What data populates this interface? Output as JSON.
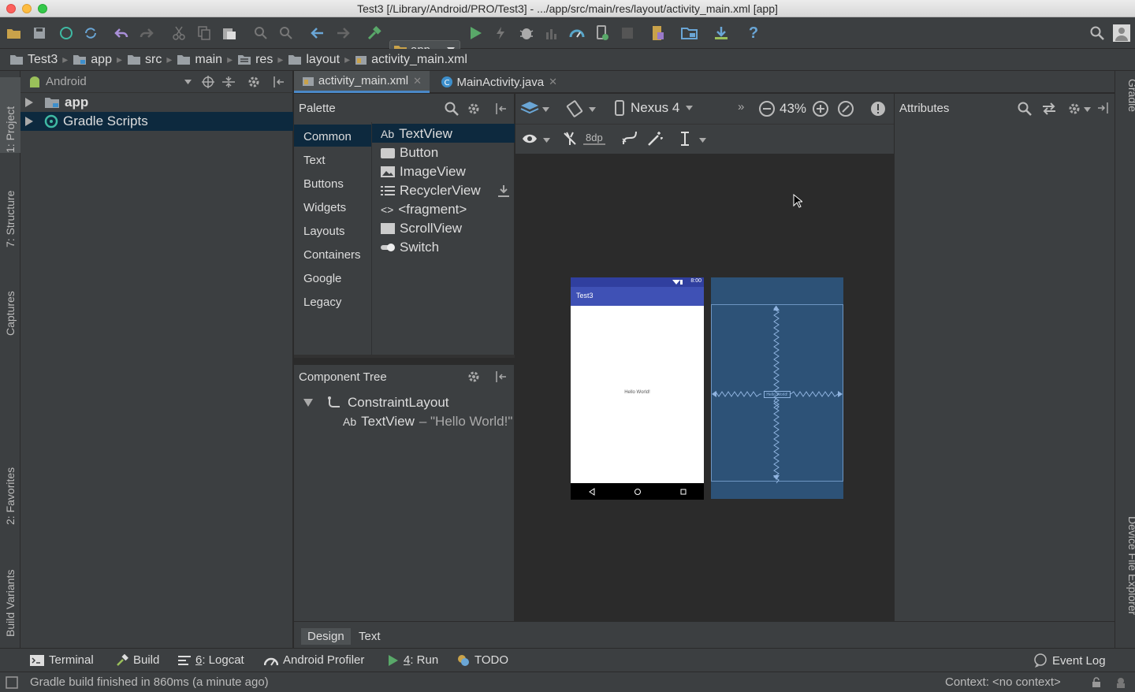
{
  "window": {
    "title": "Test3 [/Library/Android/PRO/Test3] - .../app/src/main/res/layout/activity_main.xml [app]"
  },
  "toolbar": {
    "run_config": "app",
    "icons": [
      "open-icon",
      "save-icon",
      "sync-icon",
      "refresh-icon",
      "undo-icon",
      "redo-icon",
      "cut-icon",
      "copy-icon",
      "paste-icon",
      "find-icon",
      "replace-icon",
      "back-icon",
      "forward-icon",
      "build-icon",
      "run-icon",
      "apply-changes-icon",
      "debug-icon",
      "profile-icon",
      "coverage-icon",
      "attach-icon",
      "stop-icon",
      "avd-icon",
      "sdk-icon",
      "download-icon",
      "help-icon",
      "search-icon",
      "avatar-icon"
    ]
  },
  "breadcrumb": [
    "Test3",
    "app",
    "src",
    "main",
    "res",
    "layout",
    "activity_main.xml"
  ],
  "left_strip": {
    "project": "1: Project",
    "structure": "7: Structure",
    "captures": "Captures",
    "favorites": "2: Favorites",
    "build_variants": "Build Variants"
  },
  "right_strip": {
    "gradle": "Gradle",
    "device_file_explorer": "Device File Explorer"
  },
  "project_panel": {
    "view_mode": "Android",
    "items": [
      {
        "label": "app"
      },
      {
        "label": "Gradle Scripts"
      }
    ]
  },
  "editor_tabs": [
    {
      "label": "activity_main.xml",
      "active": true
    },
    {
      "label": "MainActivity.java",
      "active": false
    }
  ],
  "palette": {
    "title": "Palette",
    "categories": [
      "Common",
      "Text",
      "Buttons",
      "Widgets",
      "Layouts",
      "Containers",
      "Google",
      "Legacy"
    ],
    "selected_category": "Common",
    "items": [
      {
        "prefix": "Ab",
        "label": "TextView"
      },
      {
        "label": "Button"
      },
      {
        "label": "ImageView"
      },
      {
        "label": "RecyclerView"
      },
      {
        "prefix": "<>",
        "label": "<fragment>"
      },
      {
        "label": "ScrollView"
      },
      {
        "label": "Switch"
      }
    ]
  },
  "component_tree": {
    "title": "Component Tree",
    "root": "ConstraintLayout",
    "child_prefix": "Ab",
    "child": "TextView",
    "child_text": "– \"Hello World!\""
  },
  "design_toolbar": {
    "device": "Nexus 4",
    "zoom": "43%",
    "margin": "8dp"
  },
  "attributes": {
    "title": "Attributes"
  },
  "preview": {
    "app_title": "Test3",
    "status_time": "8:00",
    "hello": "Hello World!",
    "blueprint_label": "Hello World!"
  },
  "design_tabs": [
    {
      "label": "Design",
      "active": true
    },
    {
      "label": "Text",
      "active": false
    }
  ],
  "tool_windows": {
    "terminal": "Terminal",
    "build": "Build",
    "logcat_num": "6",
    "logcat_rest": ": Logcat",
    "profiler": "Android Profiler",
    "run_num": "4",
    "run_rest": ": Run",
    "todo": "TODO",
    "event_log": "Event Log"
  },
  "status": {
    "message": "Gradle build finished in 860ms (a minute ago)",
    "context": "Context: <no context>"
  },
  "colors": {
    "accent": "#4a88c7",
    "app_bar": "#3f51b5",
    "blueprint": "#2d5277",
    "run_green": "#59a869"
  }
}
